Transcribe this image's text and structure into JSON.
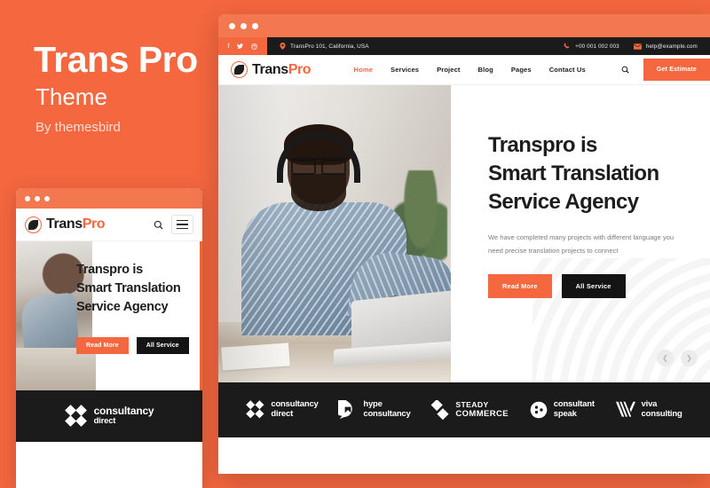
{
  "promo": {
    "title": "Trans Pro",
    "subtitle": "Theme",
    "author": "By themesbird",
    "accent": "#F4673F",
    "dark": "#1C1B1B"
  },
  "window_chrome": {
    "dots": [
      "dot-1",
      "dot-2",
      "dot-3"
    ],
    "bar_color": "#F4784F"
  },
  "topbar": {
    "social": [
      {
        "name": "facebook-icon",
        "glyph": "f"
      },
      {
        "name": "twitter-icon",
        "glyph": "✈"
      },
      {
        "name": "dribbble-icon",
        "glyph": "◉"
      }
    ],
    "address_icon": "location-pin-icon",
    "address": "TransPro 101, California, USA",
    "phone_icon": "phone-icon",
    "phone": "+00 001 002 003",
    "email_icon": "envelope-icon",
    "email": "help@example.com"
  },
  "brand": {
    "logo_icon": "transpro-globe-logo-icon",
    "name_first": "Trans",
    "name_second": "Pro"
  },
  "nav": {
    "links": [
      {
        "label": "Home",
        "active": true
      },
      {
        "label": "Services",
        "active": false
      },
      {
        "label": "Project",
        "active": false
      },
      {
        "label": "Blog",
        "active": false
      },
      {
        "label": "Pages",
        "active": false
      },
      {
        "label": "Contact Us",
        "active": false
      }
    ],
    "search_icon": "search-icon",
    "cta_label": "Get Estimate",
    "menu_icon": "hamburger-menu-icon"
  },
  "hero": {
    "heading_line1": "Transpro is",
    "heading_line2": "Smart Translation",
    "heading_line3": "Service Agency",
    "paragraph": "We have completed many projects with different language you need precise translation projects to connect",
    "primary_btn": "Read More",
    "secondary_btn": "All Service",
    "photo_alt": "man-with-headset-at-laptop-photo",
    "prev_icon": "chevron-left-icon",
    "next_icon": "chevron-right-icon"
  },
  "brands": [
    {
      "icon": "four-diamonds-icon",
      "line1": "consultancy",
      "line2": "direct",
      "caps": false
    },
    {
      "icon": "speech-bubble-icon",
      "line1": "hype",
      "line2": "consultancy",
      "caps": false
    },
    {
      "icon": "two-diamonds-icon",
      "line1": "STEADY",
      "line2": "COMMERCE",
      "caps": true
    },
    {
      "icon": "circle-face-icon",
      "line1": "consultant",
      "line2": "speak",
      "caps": false
    },
    {
      "icon": "striped-v-icon",
      "line1": "viva",
      "line2": "consulting",
      "caps": false
    }
  ],
  "small_window": {
    "brand_footer": {
      "icon": "four-diamonds-icon",
      "line1": "consultancy",
      "line2": "direct"
    }
  }
}
